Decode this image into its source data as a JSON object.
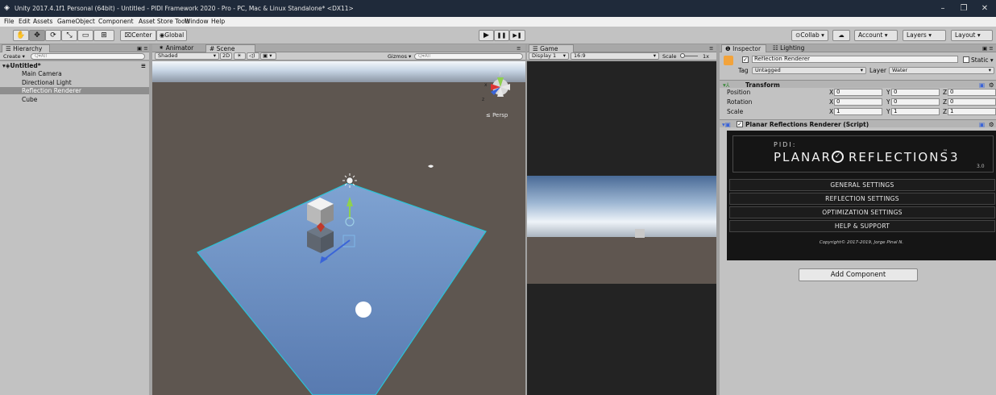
{
  "window": {
    "title": "Unity 2017.4.1f1 Personal (64bit) - Untitled - PIDI Framework 2020 - Pro - PC, Mac & Linux Standalone* <DX11>",
    "minimize": "–",
    "maximize": "❐",
    "close": "✕"
  },
  "menu": [
    "File",
    "Edit",
    "Assets",
    "GameObject",
    "Component",
    "Asset Store Tools",
    "Window",
    "Help"
  ],
  "toolbar": {
    "tools": [
      "hand-tool",
      "move-tool",
      "rotate-tool",
      "scale-tool",
      "rect-tool",
      "transform-tool"
    ],
    "tool_glyphs": [
      "✋",
      "✥",
      "⟳",
      "⤡",
      "▭",
      "⊞"
    ],
    "pivot": "⌧Center",
    "space": "◉Global",
    "play": "▶",
    "pause": "❚❚",
    "step": "▶❚",
    "collab": "⊙Collab ▾",
    "cloud": "☁",
    "account": "Account",
    "layers": "Layers",
    "layout": "Layout"
  },
  "hierarchy": {
    "tab": "☰ Hierarchy",
    "create": "Create ▾",
    "search_placeholder": "Q▾All",
    "scene": "Untitled*",
    "items": [
      "Main Camera",
      "Directional Light",
      "Reflection Renderer",
      "Cube"
    ],
    "selected": 2
  },
  "scene_tabs": {
    "animator": "⁕ Animator",
    "scene": "# Scene",
    "shaded": "Shaded",
    "mode2d": "2D",
    "light": "☀",
    "audio": "◁)",
    "fx": "▣ ▾",
    "gizmos": "Gizmos ▾",
    "search_placeholder": "Q▾All",
    "persp": "≤ Persp",
    "axis_x": "x",
    "axis_y": "y",
    "axis_z": "z"
  },
  "game": {
    "tab": "☰ Game",
    "display": "Display 1",
    "aspect": "16:9",
    "scale_label": "Scale",
    "scale_value": "1x"
  },
  "inspector": {
    "tab_inspector": "❶ Inspector",
    "tab_lighting": "☷ Lighting",
    "object_name": "Reflection Renderer",
    "static": "Static ▾",
    "tag_label": "Tag",
    "tag_value": "Untagged",
    "layer_label": "Layer",
    "layer_value": "Water",
    "transform": {
      "title": "Transform",
      "rows": [
        {
          "label": "Position",
          "x": "0",
          "y": "0",
          "z": "0"
        },
        {
          "label": "Rotation",
          "x": "0",
          "y": "0",
          "z": "0"
        },
        {
          "label": "Scale",
          "x": "1",
          "y": "1",
          "z": "1"
        }
      ]
    },
    "script": {
      "title": "Planar Reflections Renderer (Script)"
    },
    "pidi": {
      "brand": "PIDI:",
      "name_left": "PLANAR",
      "name_right": "REFLECTIONS",
      "tm": "™",
      "num": "3",
      "version": "3.0",
      "buttons": [
        "GENERAL SETTINGS",
        "REFLECTION SETTINGS",
        "OPTIMIZATION SETTINGS",
        "HELP & SUPPORT"
      ],
      "copyright": "Copyright© 2017-2019, Jorge Pinal N."
    },
    "add_component": "Add Component"
  },
  "colors": {
    "titlebar": "#1f2a3a",
    "water": "#6e92c2",
    "water_edge": "#29c4d6",
    "sky": "#e6eef6",
    "ground": "#5e5650"
  }
}
